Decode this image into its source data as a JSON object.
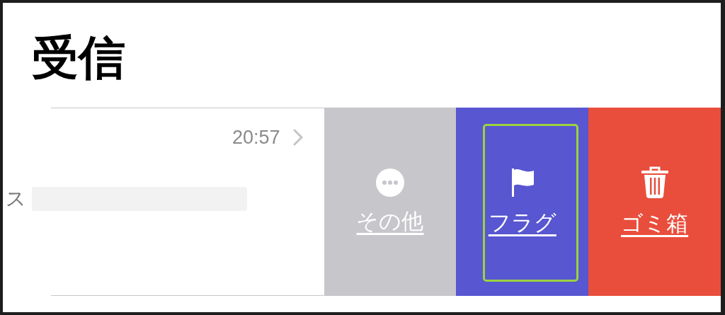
{
  "title": "受信",
  "message": {
    "sender_fragment": "ス",
    "time": "20:57"
  },
  "actions": [
    {
      "label": "その他",
      "kind": "more",
      "color": "#c7c6cb",
      "highlighted": false
    },
    {
      "label": "フラグ",
      "kind": "flag",
      "color": "#5856d0",
      "highlighted": true
    },
    {
      "label": "ゴミ箱",
      "kind": "trash",
      "color": "#e94e3c",
      "highlighted": false
    }
  ]
}
